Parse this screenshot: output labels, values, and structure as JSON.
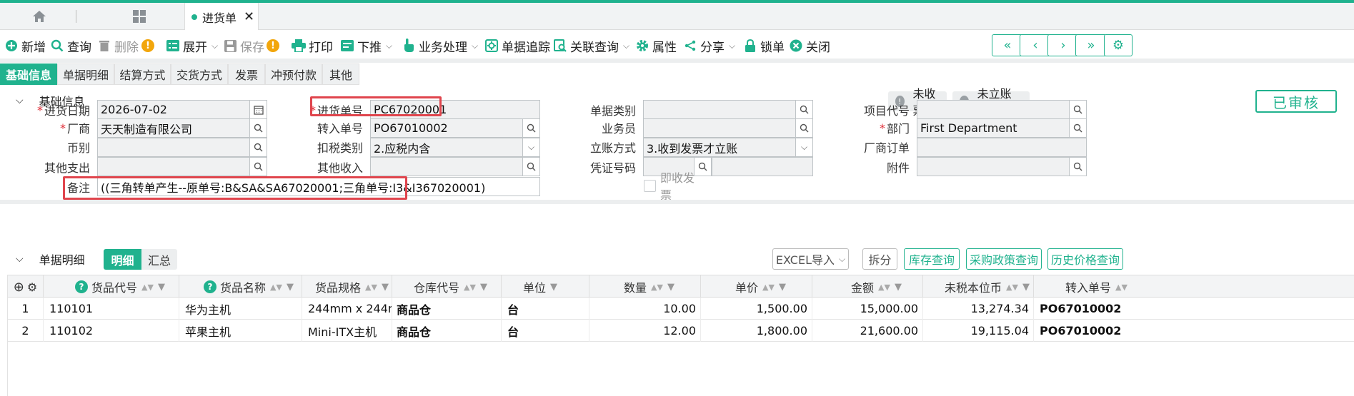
{
  "tabs": {
    "doc_title": "进货单"
  },
  "toolbar": {
    "new": "新增",
    "query": "查询",
    "delete": "删除",
    "expand": "展开",
    "save": "保存",
    "print": "打印",
    "push": "下推",
    "business": "业务处理",
    "trace": "单据追踪",
    "related": "关联查询",
    "attributes": "属性",
    "share": "分享",
    "lock": "锁单",
    "close": "关闭"
  },
  "subtabs": [
    "基础信息",
    "单据明细",
    "结算方式",
    "交货方式",
    "发票",
    "冲预付款",
    "其他"
  ],
  "basic": {
    "section_title": "基础信息",
    "status": {
      "not_received_invoice": "未收票",
      "not_closed": "未立账结案",
      "audited": "已审核"
    },
    "labels": {
      "date": "进货日期",
      "vendor": "厂商",
      "currency": "币别",
      "other_expense": "其他支出",
      "remark": "备注",
      "doc_no": "进货单号",
      "transfer_no": "转入单号",
      "tax_type": "扣税类别",
      "other_income": "其他收入",
      "doc_category": "单据类别",
      "salesman": "业务员",
      "account_method": "立账方式",
      "voucher_no": "凭证号码",
      "instant_invoice": "即收发票",
      "project_code": "项目代号",
      "department": "部门",
      "vendor_order": "厂商订单",
      "attachment": "附件"
    },
    "values": {
      "date": "2026-07-02",
      "vendor": "天天制造有限公司",
      "currency": "",
      "other_expense": "",
      "remark": "((三角转单产生--原单号:B&SA&SA67020001;三角单号:I3&I367020001)",
      "doc_no": "PC67020001",
      "transfer_no": "PO67010002",
      "tax_type": "2.应税内含",
      "other_income": "",
      "doc_category": "",
      "salesman": "",
      "account_method": "3.收到发票才立账",
      "voucher_no": "",
      "project_code": "",
      "department": "First Department",
      "vendor_order": "",
      "attachment": ""
    }
  },
  "details": {
    "section_title": "单据明细",
    "toggle": [
      "明细",
      "汇总"
    ],
    "buttons": {
      "excel": "EXCEL导入",
      "split": "拆分",
      "stock": "库存查询",
      "policy": "采购政策查询",
      "history": "历史价格查询"
    },
    "columns": [
      "货品代号",
      "货品名称",
      "货品规格",
      "仓库代号",
      "单位",
      "数量",
      "单价",
      "金额",
      "未税本位币",
      "转入单号"
    ],
    "rows": [
      [
        "1",
        "110101",
        "华为主机",
        "244mm x 244m…",
        "商品仓",
        "台",
        "10.00",
        "1,500.00",
        "15,000.00",
        "13,274.34",
        "PO67010002"
      ],
      [
        "2",
        "110102",
        "苹果主机",
        "Mini-ITX主机",
        "商品仓",
        "台",
        "12.00",
        "1,800.00",
        "21,600.00",
        "19,115.04",
        "PO67010002"
      ]
    ]
  }
}
